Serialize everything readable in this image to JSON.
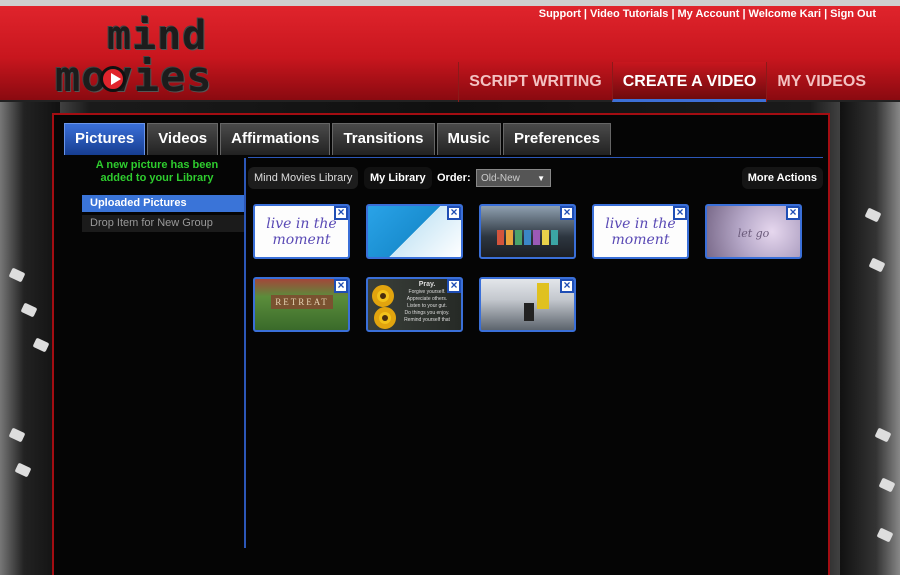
{
  "header": {
    "links": [
      "Support",
      "Video Tutorials",
      "My Account",
      "Welcome Kari",
      "Sign Out"
    ],
    "logo_line1": "mind",
    "logo_line2": "movies",
    "nav": [
      "SCRIPT WRITING",
      "CREATE A VIDEO",
      "MY VIDEOS"
    ],
    "active_nav": "CREATE A VIDEO"
  },
  "tabs": [
    "Pictures",
    "Videos",
    "Affirmations",
    "Transitions",
    "Music",
    "Preferences"
  ],
  "active_tab": "Pictures",
  "notice": "A new picture has been added to your Library",
  "sidebar": {
    "items": [
      {
        "label": "Uploaded Pictures",
        "selected": true
      },
      {
        "label": "Drop Item for New Group",
        "selected": false
      }
    ]
  },
  "toolbar": {
    "library_button": "Mind Movies Library",
    "my_library_button": "My Library",
    "order_label": "Order:",
    "order_value": "Old-New",
    "more_actions": "More Actions"
  },
  "thumbnails": [
    {
      "name": "live-in-the-moment",
      "text": "live in the moment"
    },
    {
      "name": "hand-writing-pen",
      "text": ""
    },
    {
      "name": "colorful-books",
      "text": ""
    },
    {
      "name": "live-in-the-moment-2",
      "text": "live in the moment"
    },
    {
      "name": "let-go-hands",
      "text": "let go"
    },
    {
      "name": "retreat-sign",
      "text": "RETREAT"
    },
    {
      "name": "pray-sunflowers",
      "title": "Pray.",
      "lines": [
        "Forgive yourself.",
        "Appreciate others.",
        "Listen to your gut.",
        "Do things you enjoy.",
        "Remind yourself that"
      ]
    },
    {
      "name": "airport-walkway",
      "text": ""
    }
  ],
  "colors": {
    "brand_red": "#c8161e",
    "accent_blue": "#3a6fd8",
    "notice_green": "#2ecc2e"
  }
}
